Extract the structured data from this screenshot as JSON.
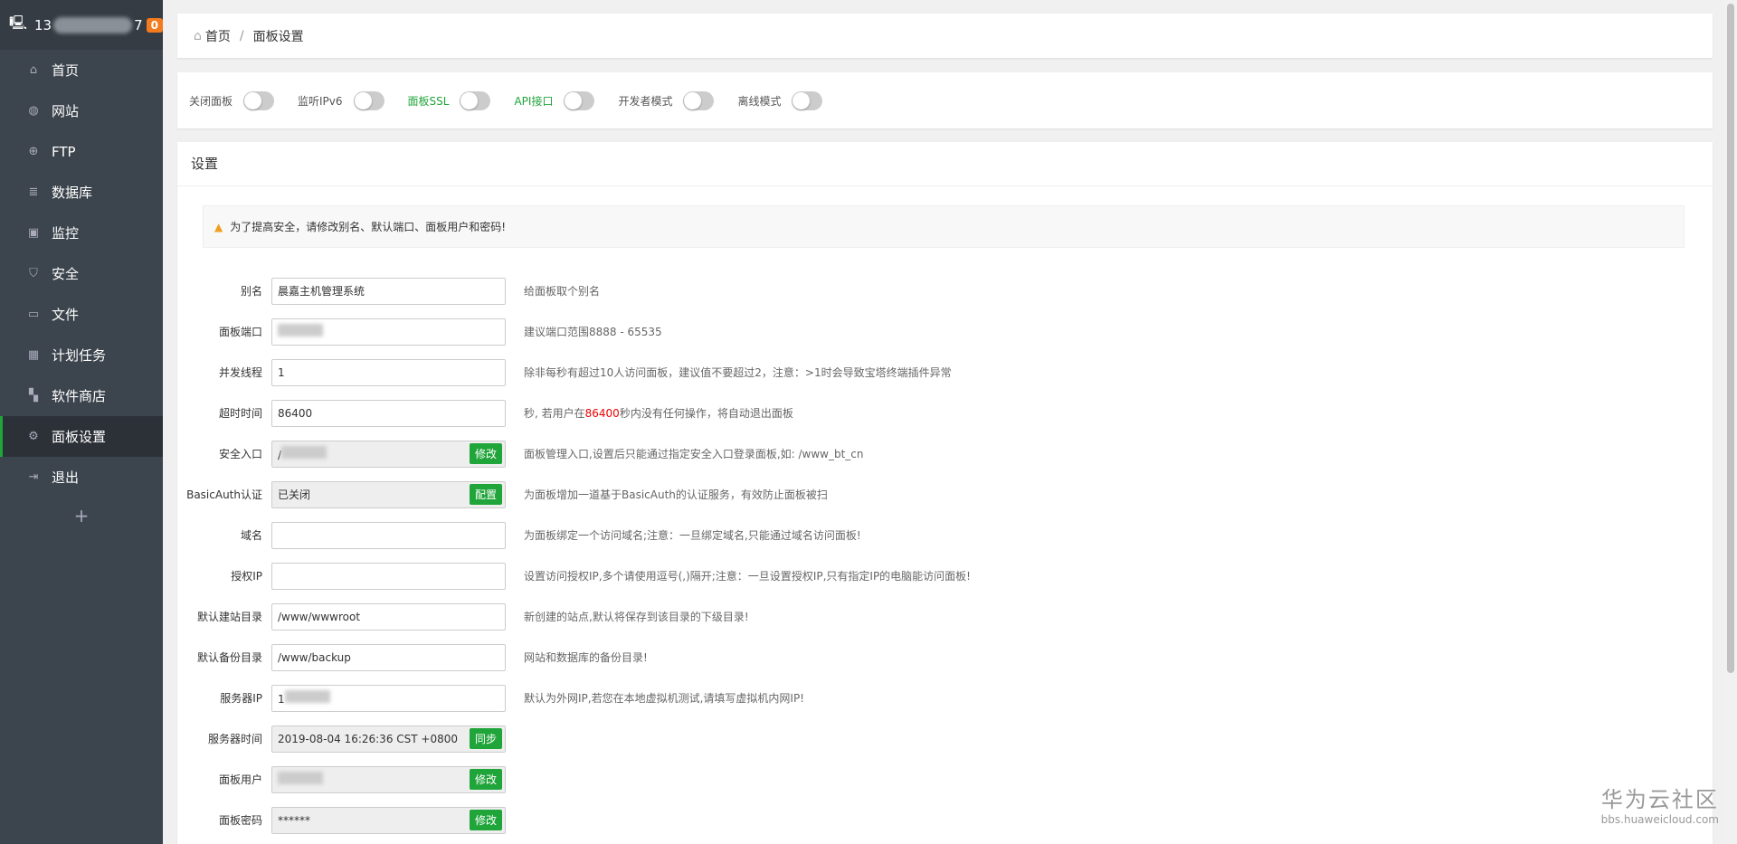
{
  "sidebar": {
    "server": "13",
    "server_tail": "7",
    "badge": "0",
    "items": [
      {
        "label": "首页",
        "icon": "home-icon"
      },
      {
        "label": "网站",
        "icon": "globe-icon"
      },
      {
        "label": "FTP",
        "icon": "ftp-icon"
      },
      {
        "label": "数据库",
        "icon": "database-icon"
      },
      {
        "label": "监控",
        "icon": "monitor-icon"
      },
      {
        "label": "安全",
        "icon": "shield-icon"
      },
      {
        "label": "文件",
        "icon": "folder-icon"
      },
      {
        "label": "计划任务",
        "icon": "calendar-icon"
      },
      {
        "label": "软件商店",
        "icon": "grid-icon"
      },
      {
        "label": "面板设置",
        "icon": "gear-icon",
        "active": true
      },
      {
        "label": "退出",
        "icon": "logout-icon"
      }
    ],
    "add": "+"
  },
  "breadcrumb": {
    "home": "首页",
    "sep": "/",
    "current": "面板设置"
  },
  "toggles": [
    {
      "label": "关闭面板",
      "on": false
    },
    {
      "label": "监听IPv6",
      "on": false
    },
    {
      "label": "面板SSL",
      "on": false,
      "color": "#20a53a"
    },
    {
      "label": "API接口",
      "on": false,
      "color": "#20a53a"
    },
    {
      "label": "开发者模式",
      "on": false
    },
    {
      "label": "离线模式",
      "on": false
    }
  ],
  "settings": {
    "title": "设置",
    "alert": "为了提高安全，请修改别名、默认端口、面板用户和密码!",
    "rows": [
      {
        "label": "别名",
        "value": "晨嘉主机管理系统",
        "hint": "给面板取个别名"
      },
      {
        "label": "面板端口",
        "value": "",
        "hint": "建议端口范围8888 - 65535"
      },
      {
        "label": "并发线程",
        "value": "1",
        "hint": "除非每秒有超过10人访问面板，建议值不要超过2，注意：>1时会导致宝塔终端插件异常"
      },
      {
        "label": "超时时间",
        "value": "86400",
        "hint_pre": "秒, 若用户在",
        "hint_red": "86400",
        "hint_post": "秒内没有任何操作，将自动退出面板"
      },
      {
        "label": "安全入口",
        "value": "/",
        "button": "修改",
        "hint": "面板管理入口,设置后只能通过指定安全入口登录面板,如: /www_bt_cn"
      },
      {
        "label": "BasicAuth认证",
        "value": "已关闭",
        "button": "配置",
        "hint": "为面板增加一道基于BasicAuth的认证服务，有效防止面板被扫"
      },
      {
        "label": "域名",
        "value": "",
        "hint": "为面板绑定一个访问域名;注意：一旦绑定域名,只能通过域名访问面板!"
      },
      {
        "label": "授权IP",
        "value": "",
        "hint": "设置访问授权IP,多个请使用逗号(,)隔开;注意：一旦设置授权IP,只有指定IP的电脑能访问面板!"
      },
      {
        "label": "默认建站目录",
        "value": "/www/wwwroot",
        "hint": "新创建的站点,默认将保存到该目录的下级目录!"
      },
      {
        "label": "默认备份目录",
        "value": "/www/backup",
        "hint": "网站和数据库的备份目录!"
      },
      {
        "label": "服务器IP",
        "value": "1",
        "hint": "默认为外网IP,若您在本地虚拟机测试,请填写虚拟机内网IP!"
      },
      {
        "label": "服务器时间",
        "value": "2019-08-04 16:26:36 CST +0800",
        "button": "同步"
      },
      {
        "label": "面板用户",
        "value": "",
        "button": "修改"
      },
      {
        "label": "面板密码",
        "value": "******",
        "button": "修改"
      }
    ]
  },
  "watermark": {
    "title": "华为云社区",
    "url": "bbs.huaweicloud.com"
  }
}
